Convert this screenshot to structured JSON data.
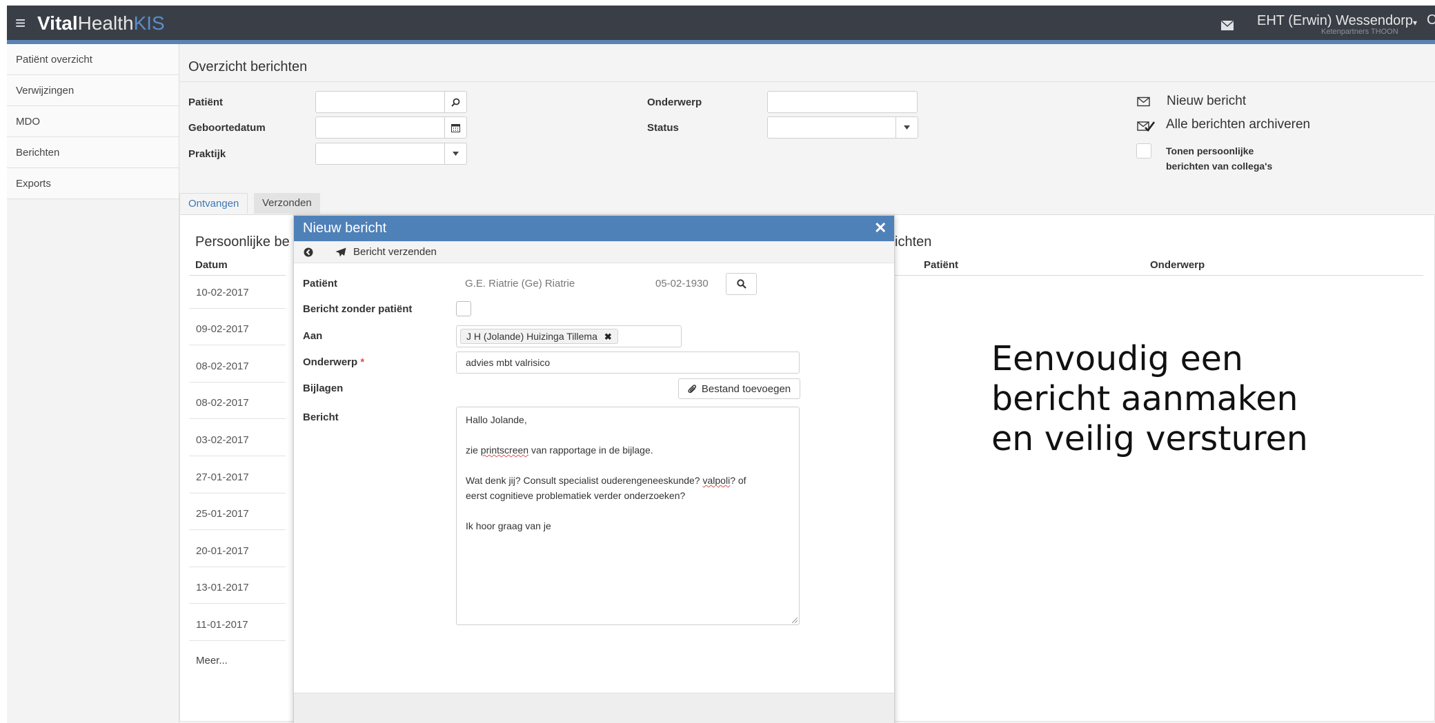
{
  "app": {
    "brand_bold": "Vital",
    "brand_mid": "Health",
    "brand_accent": "KIS"
  },
  "header": {
    "user_name": "EHT (Erwin) Wessendorp",
    "user_org": "Ketenpartners THOON",
    "user_caret": "▾",
    "extra_glyph": "C"
  },
  "sidebar": {
    "items": [
      {
        "label": "Patiënt overzicht"
      },
      {
        "label": "Verwijzingen"
      },
      {
        "label": "MDO"
      },
      {
        "label": "Berichten"
      },
      {
        "label": "Exports"
      }
    ]
  },
  "page": {
    "title": "Overzicht berichten"
  },
  "filters": {
    "patient_label": "Patiënt",
    "birthdate_label": "Geboortedatum",
    "practice_label": "Praktijk",
    "subject_label": "Onderwerp",
    "status_label": "Status"
  },
  "actions": {
    "new_message": "Nieuw bericht",
    "archive_all": "Alle berichten archiveren",
    "show_personal_line1": "Tonen persoonlijke",
    "show_personal_line2": "berichten van collega's"
  },
  "tabs": [
    {
      "label": "Ontvangen",
      "active": true
    },
    {
      "label": "Verzonden",
      "active": false
    }
  ],
  "list": {
    "title_left": "Persoonlijke be",
    "title_right": "ichten",
    "col_date": "Datum",
    "col_patient": "Patiënt",
    "col_subject": "Onderwerp",
    "dates": [
      "10-02-2017",
      "09-02-2017",
      "08-02-2017",
      "08-02-2017",
      "03-02-2017",
      "27-01-2017",
      "25-01-2017",
      "20-01-2017",
      "13-01-2017",
      "11-01-2017"
    ],
    "more": "Meer..."
  },
  "tagline": {
    "line1": "Eenvoudig een",
    "line2": "bericht aanmaken",
    "line3": "en veilig versturen"
  },
  "modal": {
    "title": "Nieuw bericht",
    "close": "✕",
    "send_label": "Bericht verzenden",
    "patient_label": "Patiënt",
    "patient_name": "G.E. Riatrie (Ge) Riatrie",
    "patient_dob": "05-02-1930",
    "no_patient_label": "Bericht zonder patiënt",
    "to_label": "Aan",
    "to_recipient": "J H (Jolande) Huizinga Tillema",
    "chip_remove": "✖",
    "subject_label": "Onderwerp",
    "required_mark": "*",
    "subject_value": "advies mbt valrisico",
    "attachments_label": "Bijlagen",
    "add_file": "Bestand toevoegen",
    "message_label": "Bericht",
    "body": {
      "l1": "Hallo Jolande,",
      "l2a": "zie ",
      "l2b": "printscreen",
      "l2c": " van rapportage in de bijlage.",
      "l3a": "Wat denk jij? Consult specialist ouderengeneeskunde? ",
      "l3b": "valpoli",
      "l3c": "? of",
      "l4": "eerst cognitieve problematiek verder onderzoeken?",
      "l5": "Ik hoor graag van je"
    }
  },
  "colors": {
    "topbar": "#3a3f47",
    "accent": "#5a83b5",
    "modal_header": "#4f81b9",
    "tab_active": "#3c77b5"
  }
}
